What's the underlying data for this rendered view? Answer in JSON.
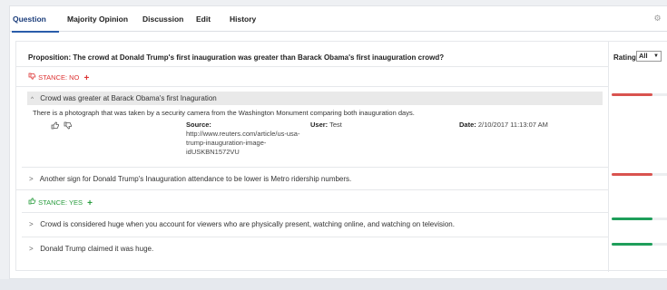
{
  "tabs": [
    {
      "label": "Question",
      "active": true
    },
    {
      "label": "Majority Opinion",
      "active": false
    },
    {
      "label": "Discussion",
      "active": false
    },
    {
      "label": "Edit",
      "active": false
    },
    {
      "label": "History",
      "active": false
    }
  ],
  "proposition": "Proposition: The crowd at Donald Trump's first inauguration was greater than Barack Obama's first inauguration crowd?",
  "rating": {
    "label": "Rating",
    "selected": "All"
  },
  "stance_no": {
    "label": "STANCE: NO"
  },
  "stance_yes": {
    "label": "STANCE: YES"
  },
  "claims_no": [
    {
      "title": "Crowd was greater at Barack Obama's first Inaguration",
      "expanded": true,
      "text": "There is a photograph that was taken by a security camera from the Washington Monument comparing both inauguration days.",
      "source_label": "Source:",
      "source_lines": [
        "http://www.reuters.com/article/us-usa-",
        "trump-inauguration-image-",
        "idUSKBN1572VU"
      ],
      "user_label": "User:",
      "user": "Test",
      "date_label": "Date:",
      "date": "2/10/2017 11:13:07 AM",
      "rating": 0.72
    },
    {
      "title": "Another sign for Donald Trump's Inauguration attendance to be lower is Metro ridership numbers.",
      "expanded": false,
      "rating": 0.72
    }
  ],
  "claims_yes": [
    {
      "title": "Crowd is considered huge when you account for viewers who are physically present, watching online, and watching on television.",
      "expanded": false,
      "rating": 0.72
    },
    {
      "title": "Donald Trump claimed it was huge.",
      "expanded": false,
      "rating": 0.72
    }
  ],
  "colors": {
    "no": "#d9534f",
    "yes": "#1e9e5a"
  }
}
